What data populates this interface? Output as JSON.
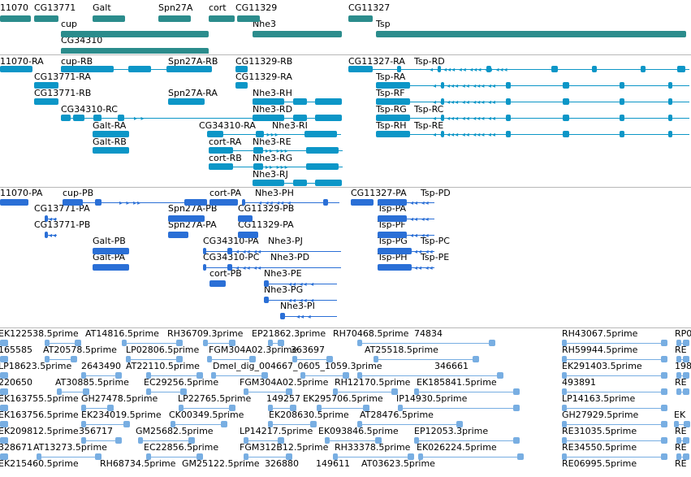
{
  "colors": {
    "gene": "#2b8c8c",
    "mrna": "#0c96c7",
    "protein": "#2a6fd6",
    "est": "#78aee2",
    "separator": "#b8b8b8"
  },
  "tracks": {
    "genes": [
      "11070",
      "CG13771",
      "Galt",
      "Spn27A",
      "cort",
      "CG11329",
      "CG11327",
      "cup",
      "Nhe3",
      "Tsp",
      "CG34310"
    ],
    "transcripts": [
      "11070-RA",
      "cup-RB",
      "Spn27A-RB",
      "CG11329-RB",
      "CG11327-RA",
      "Tsp-RD",
      "CG13771-RA",
      "CG11329-RA",
      "Tsp-RA",
      "CG13771-RB",
      "Spn27A-RA",
      "Nhe3-RH",
      "Tsp-RF",
      "CG34310-RC",
      "Nhe3-RD",
      "Tsp-RG",
      "Tsp-RC",
      "Galt-RA",
      "CG34310-RA",
      "Nhe3-RI",
      "Tsp-RH",
      "Tsp-RE",
      "Galt-RB",
      "cort-RA",
      "Nhe3-RE",
      "cort-RB",
      "Nhe3-RG",
      "Nhe3-RJ"
    ],
    "proteins": [
      "11070-PA",
      "cup-PB",
      "cort-PA",
      "Nhe3-PH",
      "CG11327-PA",
      "Tsp-PD",
      "CG13771-PA",
      "Spn27A-PB",
      "CG11329-PB",
      "Tsp-PA",
      "CG13771-PB",
      "Spn27A-PA",
      "CG11329-PA",
      "Tsp-PF",
      "Galt-PB",
      "CG34310-PA",
      "Nhe3-PJ",
      "Tsp-PG",
      "Tsp-PC",
      "Galt-PA",
      "CG34310-PC",
      "Nhe3-PD",
      "Tsp-PH",
      "Tsp-PE",
      "cort-PB",
      "Nhe3-PE",
      "Nhe3-PG",
      "Nhe3-PI"
    ],
    "ests": [
      "EK122538.5prime",
      "AT14816.5prime",
      "RH36709.3prime",
      "EP21862.3prime",
      "RH70468.5prime",
      "74834",
      "RH43067.5prime",
      "RP0",
      "165585",
      "AT20578.5prime",
      "LP02806.5prime",
      "FGM304A02.3prime",
      "363697",
      "AT25518.5prime",
      "RH59944.5prime",
      "RE",
      "LP18623.5prime",
      "2643490",
      "AT22110.5prime",
      "Dmel_dig_004667_0605_1059.3prime",
      "346661",
      "EK291403.5prime",
      "198",
      "220650",
      "AT30885.5prime",
      "EC29256.5prime",
      "FGM304A02.5prime",
      "RH12170.5prime",
      "EK185841.5prime",
      "493891",
      "RE",
      "EK163755.5prime",
      "GH27478.5prime",
      "LP22765.5prime",
      "149257",
      "EK295706.5prime",
      "IP14930.5prime",
      "LP14163.5prime",
      "EK163756.5prime",
      "EK234019.5prime",
      "CK00349.5prime",
      "EK208630.5prime",
      "AT28476.5prime",
      "GH27929.5prime",
      "EK",
      "EK209812.5prime",
      "356717",
      "GM25682.5prime",
      "LP14217.5prime",
      "EK093846.5prime",
      "EP12053.3prime",
      "RE31035.5prime",
      "RE",
      "328671",
      "AT13273.5prime",
      "EC22856.5prime",
      "FGM312B12.5prime",
      "RH33378.5prime",
      "EK026224.5prime",
      "RE34550.5prime",
      "RE",
      "EK215460.5prime",
      "RH68734.5prime",
      "GM25122.5prime",
      "326880",
      "149611",
      "AT03623.5prime",
      "RE06995.5prime",
      "RE"
    ]
  }
}
